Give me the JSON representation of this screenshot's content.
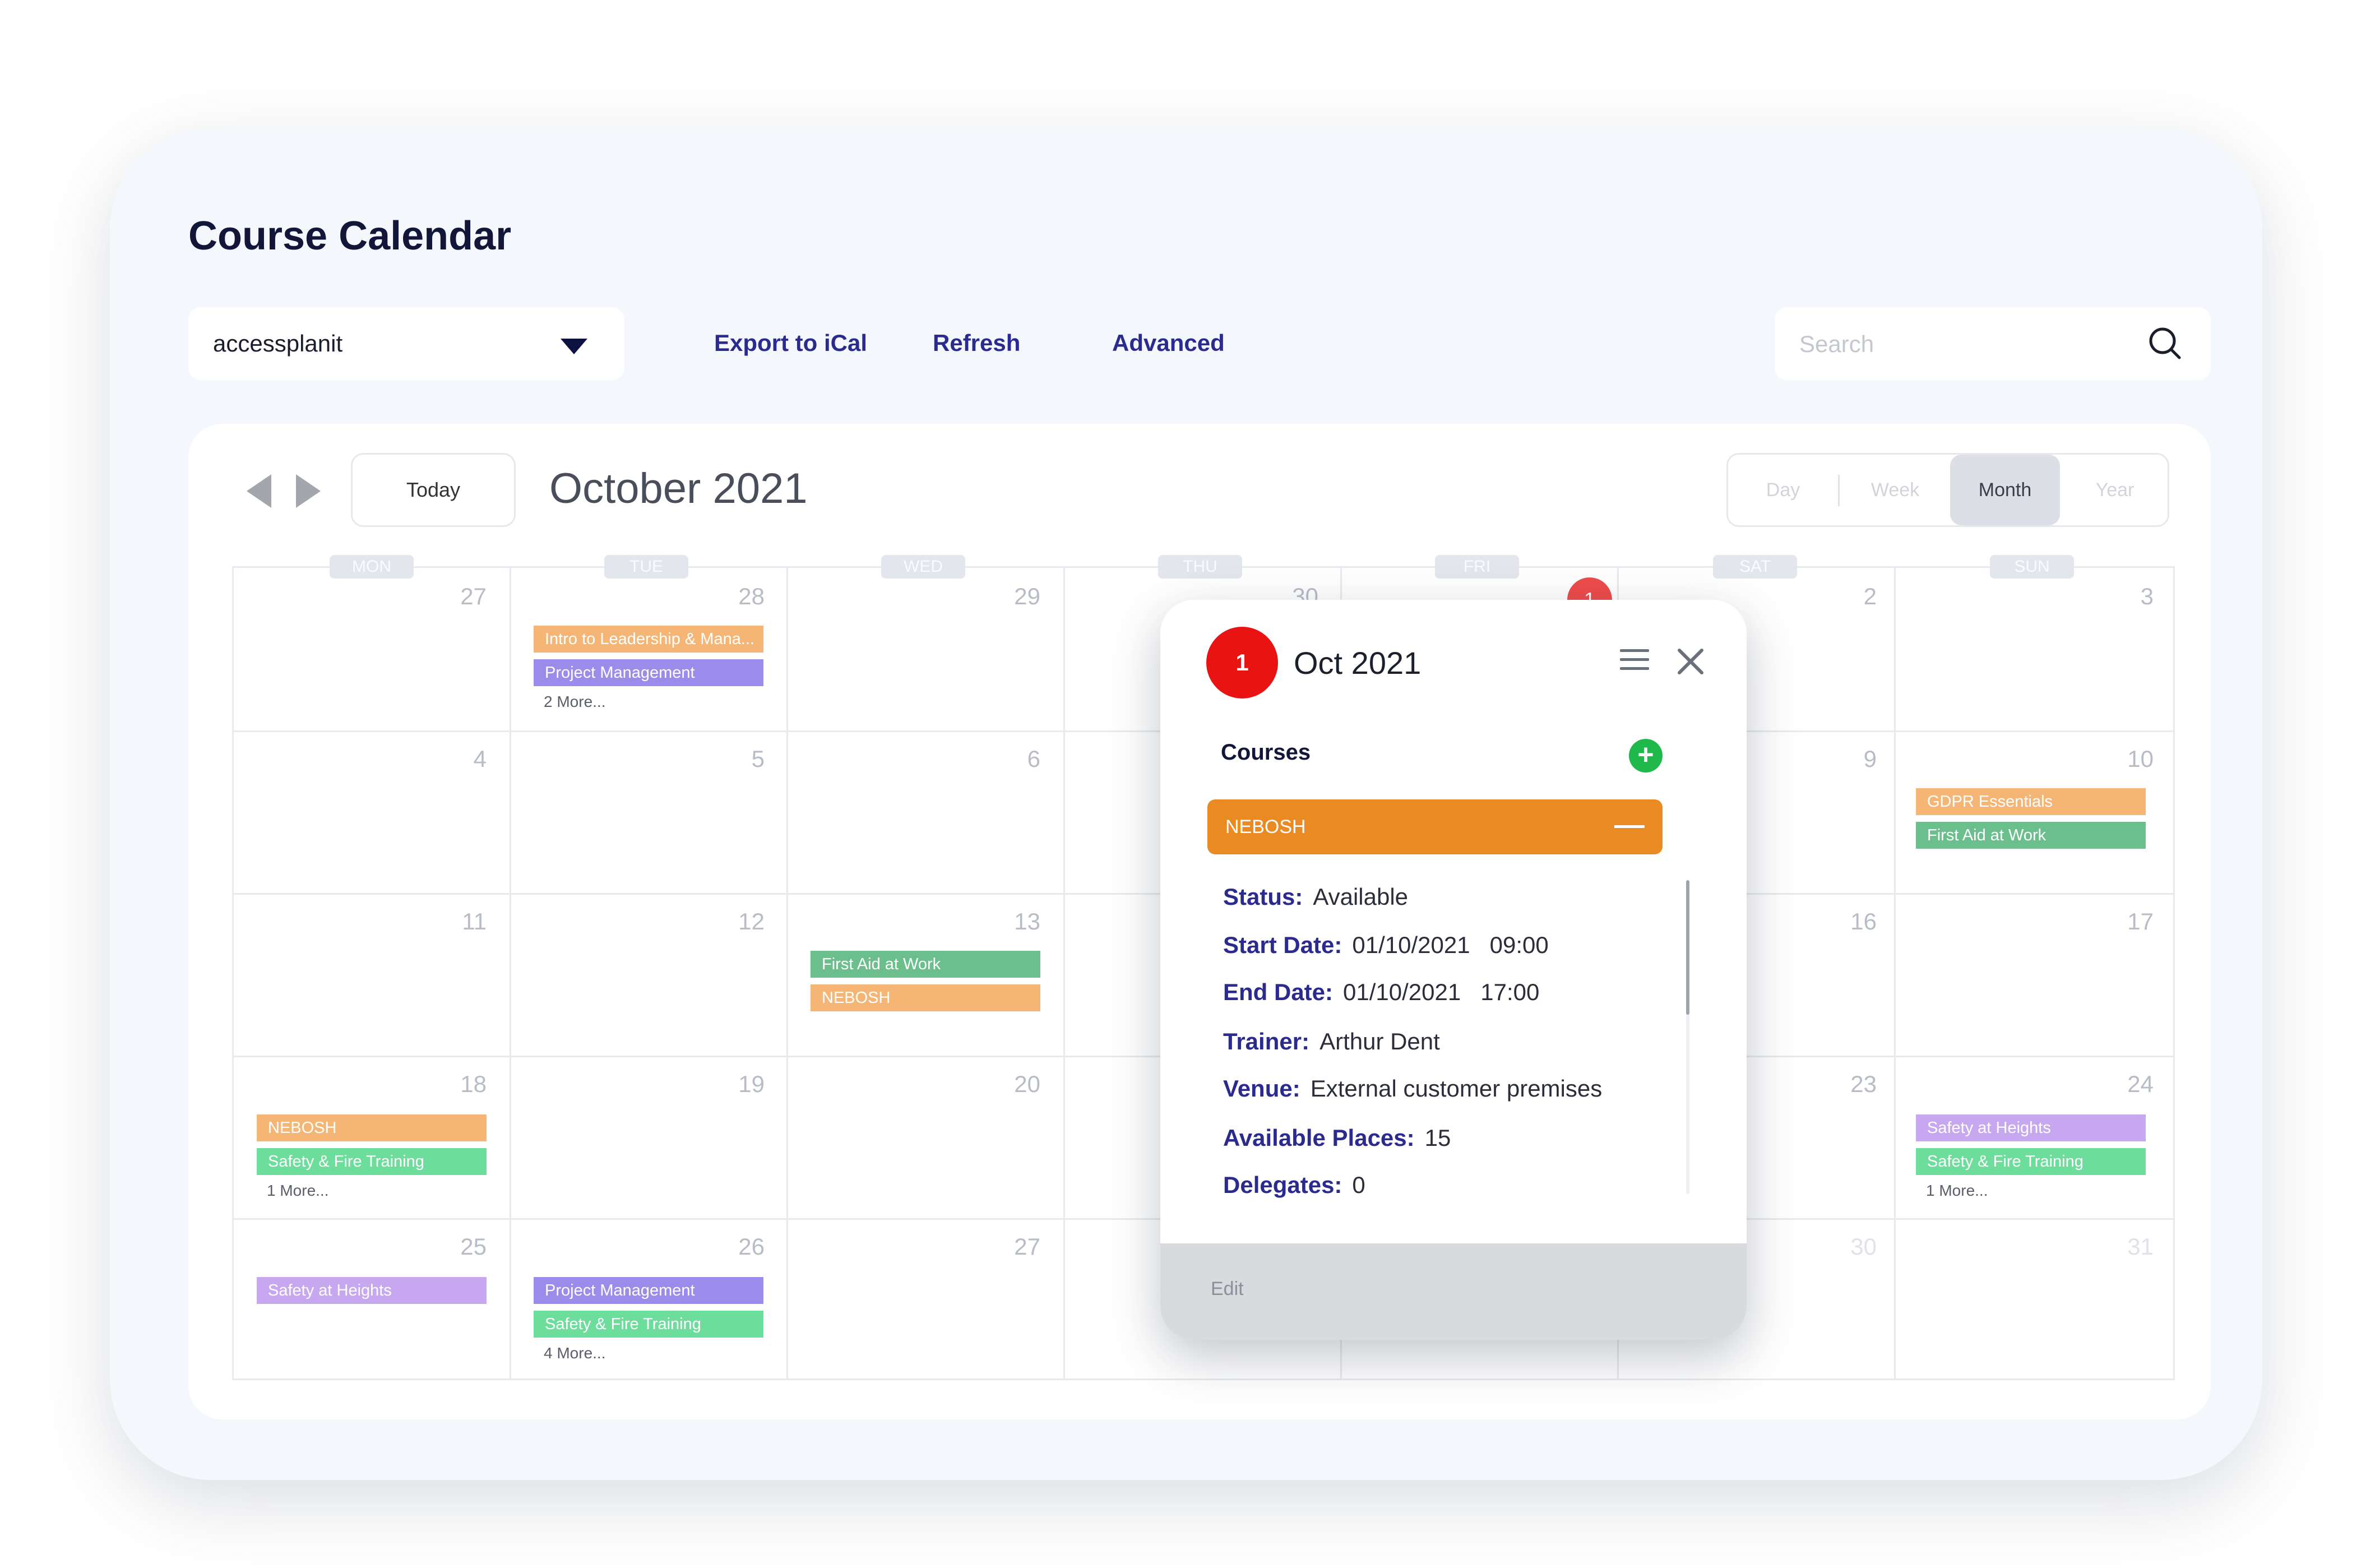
{
  "page": {
    "title": "Course Calendar"
  },
  "toolbar": {
    "account_select": "accessplanit",
    "export_label": "Export to iCal",
    "refresh_label": "Refresh",
    "advanced_label": "Advanced",
    "search_placeholder": "Search"
  },
  "calendar": {
    "today_label": "Today",
    "month_label": "October 2021",
    "views": [
      "Day",
      "Week",
      "Month",
      "Year"
    ],
    "active_view": "Month",
    "weekdays": [
      "MON",
      "TUE",
      "WED",
      "THU",
      "FRI",
      "SAT",
      "SUN"
    ],
    "today_badge": "1",
    "weeks": [
      [
        "27",
        "28",
        "29",
        "30",
        "",
        "2",
        "3"
      ],
      [
        "4",
        "5",
        "6",
        "",
        "",
        "9",
        "10"
      ],
      [
        "11",
        "12",
        "13",
        "",
        "",
        "16",
        "17"
      ],
      [
        "18",
        "19",
        "20",
        "",
        "",
        "23",
        "24"
      ],
      [
        "25",
        "26",
        "27",
        "",
        "",
        "30",
        "31"
      ]
    ],
    "events": {
      "tue28_1": "Intro to Leadership & Mana...",
      "tue28_2": "Project Management",
      "tue28_more": "2 More...",
      "sun10_1": "GDPR Essentials",
      "sun10_2": "First Aid at Work",
      "wed13_1": "First Aid at Work",
      "wed13_2": "NEBOSH",
      "mon18_1": "NEBOSH",
      "mon18_2": "Safety & Fire  Training",
      "mon18_more": "1 More...",
      "sun24_1": "Safety at Heights",
      "sun24_2": "Safety & Fire Training",
      "sun24_more": "1 More...",
      "mon25_1": "Safety at Heights",
      "tue26_1": "Project Management",
      "tue26_2": "Safety & Fire Training",
      "tue26_more": "4 More..."
    },
    "colors": {
      "orange": "#f5b675",
      "purple": "#9b8cec",
      "green": "#6abf8d",
      "mint": "#6ddd9c",
      "lavender": "#c7a8f0"
    }
  },
  "popup": {
    "day_badge": "1",
    "title": "Oct 2021",
    "courses_label": "Courses",
    "add_icon": "+",
    "course_name": "NEBOSH",
    "details": {
      "status_label": "Status:",
      "status_value": "Available",
      "start_label": "Start Date:",
      "start_value": "01/10/2021   09:00",
      "end_label": "End Date:",
      "end_value": "01/10/2021   17:00",
      "trainer_label": "Trainer:",
      "trainer_value": "Arthur Dent",
      "venue_label": "Venue:",
      "venue_value": "External customer premises",
      "places_label": "Available Places:",
      "places_value": "15",
      "delegates_label": "Delegates:",
      "delegates_value": "0"
    },
    "edit_label": "Edit"
  }
}
